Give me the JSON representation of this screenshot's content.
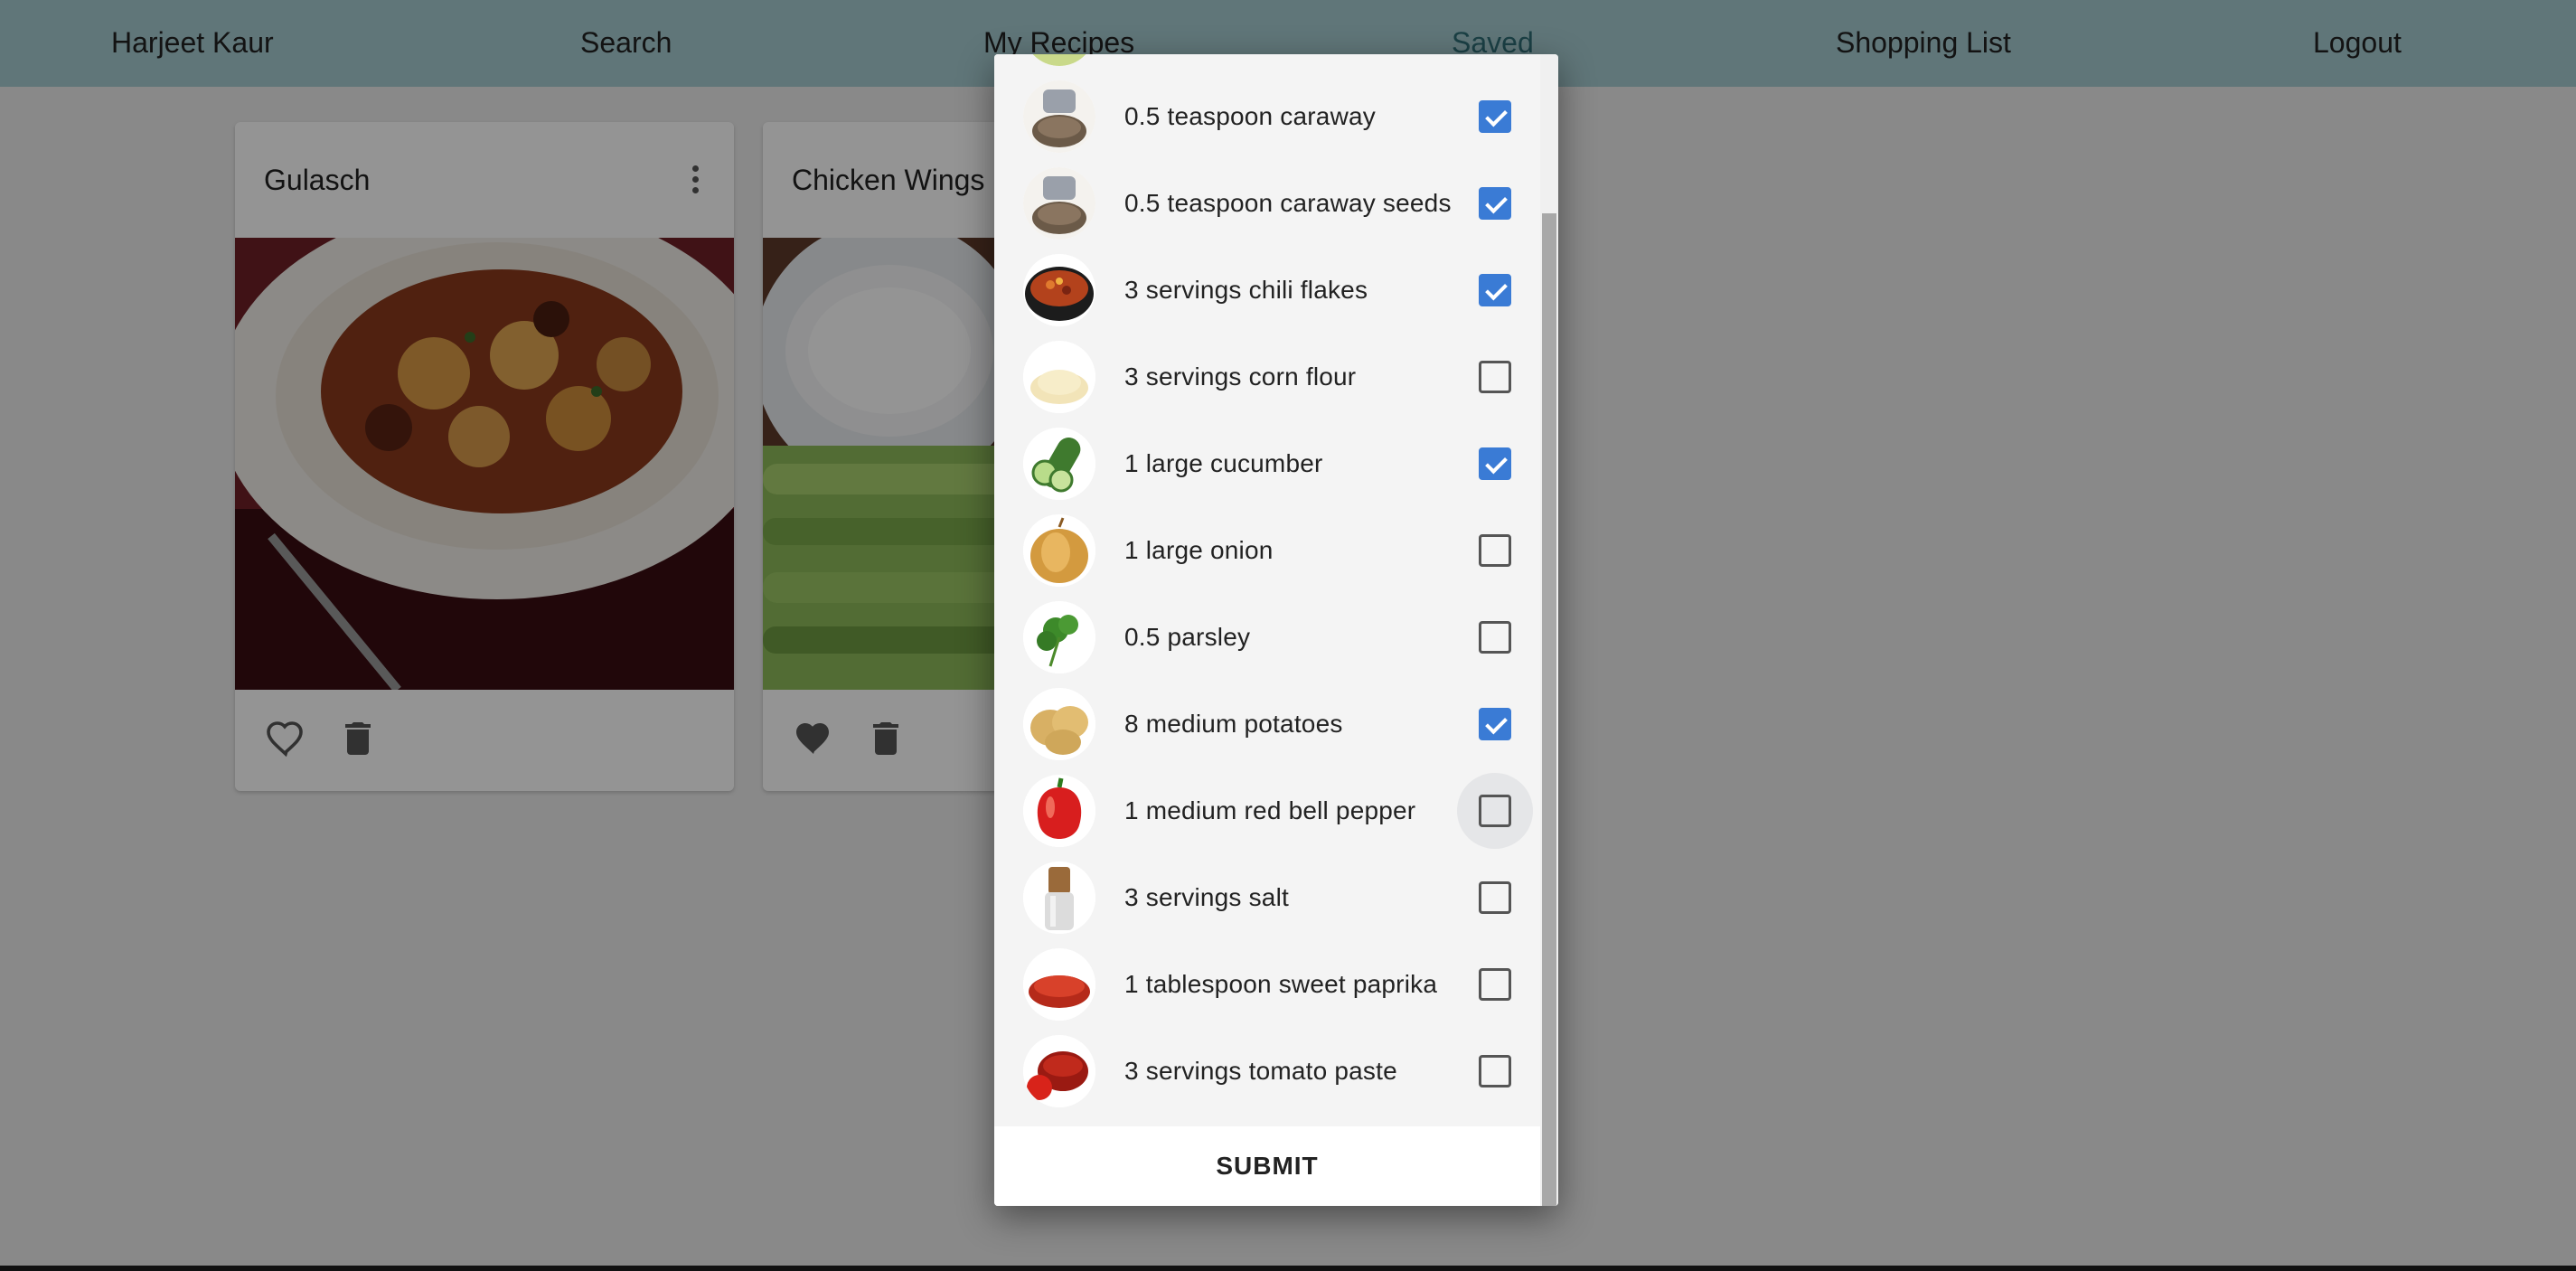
{
  "nav": {
    "user": "Harjeet Kaur",
    "search": "Search",
    "my_recipes": "My Recipes",
    "saved": "Saved",
    "shopping_list": "Shopping List",
    "logout": "Logout"
  },
  "cards": [
    {
      "title": "Gulasch",
      "favorite": false
    },
    {
      "title": "Chicken Wings",
      "favorite": true
    }
  ],
  "dialog": {
    "items": [
      {
        "label": "0.5 teaspoon caraway",
        "checked": true,
        "icon": "caraway-image"
      },
      {
        "label": "0.5 teaspoon caraway seeds",
        "checked": true,
        "icon": "caraway-seeds-image"
      },
      {
        "label": "3 servings chili flakes",
        "checked": true,
        "icon": "chili-flakes-image"
      },
      {
        "label": "3 servings corn flour",
        "checked": false,
        "icon": "corn-flour-image"
      },
      {
        "label": "1 large cucumber",
        "checked": true,
        "icon": "cucumber-image"
      },
      {
        "label": "1 large onion",
        "checked": false,
        "icon": "onion-image"
      },
      {
        "label": "0.5 parsley",
        "checked": false,
        "icon": "parsley-image"
      },
      {
        "label": "8 medium potatoes",
        "checked": true,
        "icon": "potatoes-image"
      },
      {
        "label": "1 medium red bell pepper",
        "checked": false,
        "icon": "red-bell-pepper-image",
        "hovered": true
      },
      {
        "label": "3 servings salt",
        "checked": false,
        "icon": "salt-image"
      },
      {
        "label": "1 tablespoon sweet paprika",
        "checked": false,
        "icon": "sweet-paprika-image"
      },
      {
        "label": "3 servings tomato paste",
        "checked": false,
        "icon": "tomato-paste-image"
      }
    ],
    "submit_label": "SUBMIT"
  },
  "colors": {
    "navbar": "#a6cbd0",
    "saved_link": "#2f6f78",
    "checkbox_checked": "#3a7bd5"
  }
}
